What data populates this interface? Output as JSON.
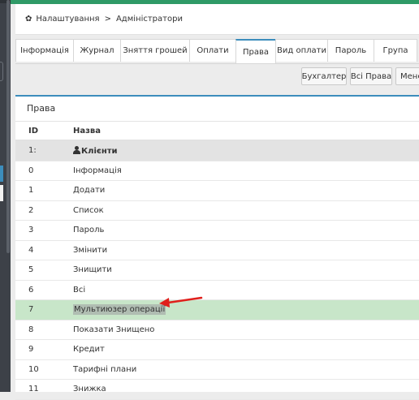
{
  "breadcrumb": {
    "section": "Налаштування",
    "separator": ">",
    "page": "Адміністратори"
  },
  "tabs": [
    {
      "label": "Інформація",
      "active": false
    },
    {
      "label": "Журнал",
      "active": false
    },
    {
      "label": "Зняття грошей",
      "active": false
    },
    {
      "label": "Оплати",
      "active": false
    },
    {
      "label": "Права",
      "active": true
    },
    {
      "label": "Вид оплати",
      "active": false
    },
    {
      "label": "Пароль",
      "active": false
    },
    {
      "label": "Група",
      "active": false
    }
  ],
  "buttons": {
    "accountant": "Бухгалтер",
    "all_rights": "Всі Права",
    "manager": "Мене"
  },
  "panel": {
    "title": "Права"
  },
  "table": {
    "headers": {
      "id": "ID",
      "name": "Назва"
    },
    "group": {
      "id": "1:",
      "name": "Клієнти"
    },
    "rows": [
      {
        "id": "0",
        "name": "Інформація"
      },
      {
        "id": "1",
        "name": "Додати"
      },
      {
        "id": "2",
        "name": "Список"
      },
      {
        "id": "3",
        "name": "Пароль"
      },
      {
        "id": "4",
        "name": "Змінити"
      },
      {
        "id": "5",
        "name": "Знищити"
      },
      {
        "id": "6",
        "name": "Всі"
      },
      {
        "id": "7",
        "name": "Мультиюзер операції"
      },
      {
        "id": "8",
        "name": "Показати Знищено"
      },
      {
        "id": "9",
        "name": "Кредит"
      },
      {
        "id": "10",
        "name": "Тарифні плани"
      },
      {
        "id": "11",
        "name": "Знижка"
      }
    ]
  },
  "colors": {
    "accent": "#3c8dbc",
    "topbar": "#2f9a67",
    "highlight_row": "#c8e6c9",
    "arrow": "#e0201c"
  }
}
